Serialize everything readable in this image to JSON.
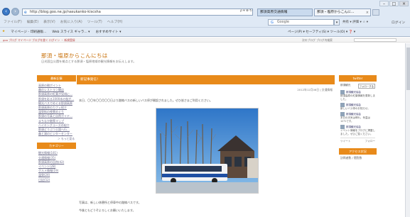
{
  "window": {
    "controls": [
      "–",
      "□",
      "×"
    ]
  },
  "nav": {
    "back_icon": "back-arrow-icon",
    "forward_icon": "forward-arrow-icon",
    "url": "http://blog.goo.ne.jp/nasukanko-kiscsha",
    "addr_actions": "ρ ▾ ⊗ ↻",
    "tabs": [
      {
        "label": "那須高原交通情報",
        "active": true
      },
      {
        "label": "那須・塩原からこんに...",
        "active": false
      }
    ]
  },
  "menu": {
    "items": [
      "ファイル(F)",
      "編集(E)",
      "表示(V)",
      "お気に入り(A)",
      "ツール(T)",
      "ヘルプ(H)"
    ],
    "search_label": "Google",
    "right_tools": "共有 ▾ 評価 ▾ ☆ ▾",
    "login": "ログイン"
  },
  "favorites": {
    "items": [
      "マイページ - 印刷通販...",
      "Web スライス ギャラ... ▾",
      "おすすめサイト ▾"
    ],
    "tools": "ページ(P) ▾  セーフティ(S) ▾  ツール(O) ▾  ❓ ▾"
  },
  "blog_bar": {
    "left": "goo ブログ  マイページ  ブログを書く  ログイン ・ 新規登録",
    "right": "次のブログ  ブログ内検索"
  },
  "blog": {
    "title": "那須・塩原からこんにちは",
    "subtitle": "日光国立公園を拠点とする那須・塩原地域の観光情報をお伝えします。"
  },
  "left_sidebar": {
    "recent_head": "最新記事",
    "recent": [
      "高原の朝ポイント",
      "森のレストラン開店",
      "那須高原の紅葉が見頃に…",
      "那須を彩る1000本の桜が…",
      "観光バスでめぐる那須高原",
      "那須高原のカフェ紹介",
      "温泉街の夜景めぐり",
      "那須の写真と自然ガイド…",
      "まちなか散策マップ",
      "ハイキングコースの紹介",
      "那須どうぶつ王国へ行…",
      "森と湖のビジターセンター"
    ],
    "recent_more": "＞ もっと見る",
    "category_head": "カテゴリー",
    "categories": [
      "観光情報(181)",
      "交通情報(35)",
      "那須高原の自然(42)",
      "イベント(28)",
      "グルメ情報(19)",
      "温泉(24)",
      "日記(52)"
    ]
  },
  "main": {
    "heading": "新記事発信！",
    "meta": "2012年12月06日 | 交通情報",
    "body": "本日、〇〇年〇〇月〇〇日より路線バスの新しいバス停が開設されました。ぜひ皆さまご利用ください。",
    "caption1": "写真は、新しい休憩所と停車中の路線バスです。",
    "caption2": "今後ともどうぞよろしくお願いいたします。"
  },
  "right_sidebar": {
    "head": "twitter",
    "follow_label": "フォローする",
    "handle": "那須観光",
    "tweets": [
      {
        "user": "那須観光協会",
        "text": "那須高原の紅葉情報を更新しました。"
      },
      {
        "user": "那須観光協会",
        "text": "新しいバス停のお知らせ。"
      },
      {
        "user": "那須観光協会",
        "text": "本日の天気は晴れ、気温は12℃です。"
      },
      {
        "user": "那須観光協会",
        "text": "イベント情報をブログに掲載しました。ぜひご覧ください。"
      }
    ],
    "foot_left": "ツイート",
    "foot_right": "フォロー",
    "access_head": "アクセス状況",
    "access_body": "訪問者数 / 閲覧数"
  }
}
